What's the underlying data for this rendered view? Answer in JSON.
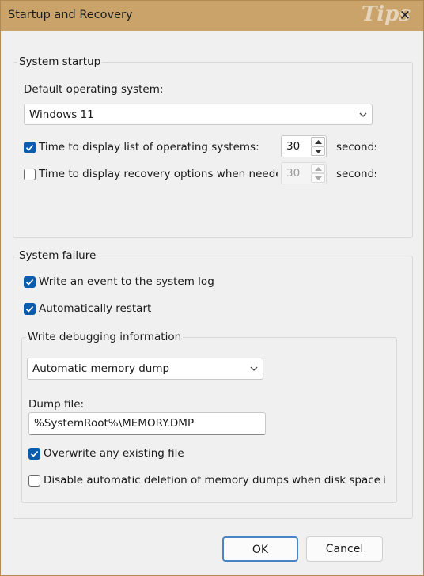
{
  "window": {
    "title": "Startup and Recovery",
    "close_glyph": "✕",
    "watermark": "Tips"
  },
  "system_startup": {
    "group_label": "System startup",
    "default_os_label": "Default operating system:",
    "default_os_value": "Windows 11",
    "display_list": {
      "label": "Time to display list of operating systems:",
      "checked": true,
      "value": "30",
      "unit": "seconds"
    },
    "display_recovery": {
      "label": "Time to display recovery options when needed:",
      "checked": false,
      "value": "30",
      "unit": "seconds"
    }
  },
  "system_failure": {
    "group_label": "System failure",
    "write_event": {
      "label": "Write an event to the system log",
      "checked": true
    },
    "auto_restart": {
      "label": "Automatically restart",
      "checked": true
    },
    "debug": {
      "group_label": "Write debugging information",
      "dump_type": "Automatic memory dump",
      "dump_file_label": "Dump file:",
      "dump_file_value": "%SystemRoot%\\MEMORY.DMP",
      "overwrite": {
        "label": "Overwrite any existing file",
        "checked": true
      },
      "disable_auto_delete": {
        "label": "Disable automatic deletion of memory dumps when disk space is low",
        "checked": false
      }
    }
  },
  "buttons": {
    "ok": "OK",
    "cancel": "Cancel"
  },
  "colors": {
    "accent": "#0b5cad",
    "titlebar": "#c9a36a",
    "background": "#f0f0f0"
  },
  "icons": {
    "close": "close-icon",
    "check": "checkmark-icon",
    "chevron": "chevron-down-icon",
    "spin_up": "arrow-up-icon",
    "spin_down": "arrow-down-icon"
  }
}
